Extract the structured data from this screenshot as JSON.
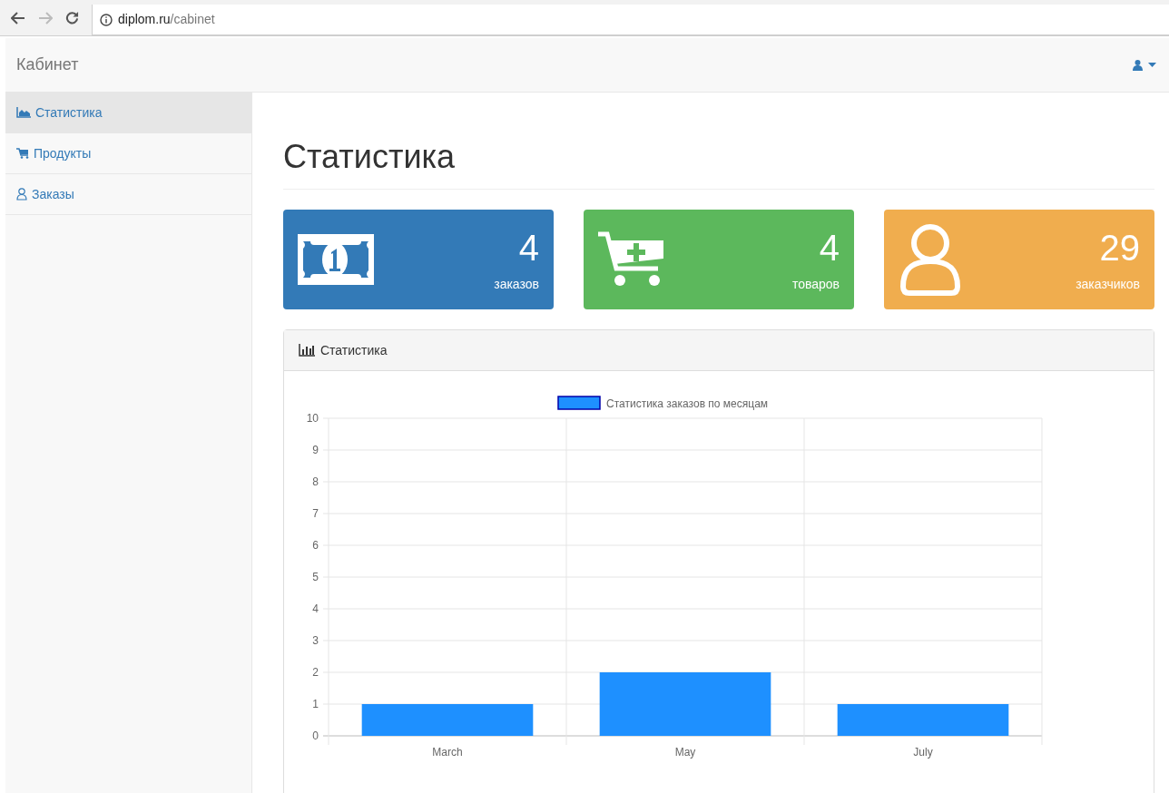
{
  "browser": {
    "url_host": "diplom.ru",
    "url_path": "/cabinet"
  },
  "navbar": {
    "brand": "Кабинет"
  },
  "sidebar": {
    "items": [
      {
        "label": "Статистика",
        "kind": "area-chart",
        "selected": true
      },
      {
        "label": "Продукты",
        "kind": "cart",
        "selected": false
      },
      {
        "label": "Заказы",
        "kind": "user",
        "selected": false
      }
    ]
  },
  "page_title": "Статистика",
  "stat_cards": [
    {
      "value": "4",
      "label": "заказов",
      "color": "#337ab7",
      "kind": "money"
    },
    {
      "value": "4",
      "label": "товаров",
      "color": "#5cb85c",
      "kind": "cart"
    },
    {
      "value": "29",
      "label": "заказчиков",
      "color": "#f0ad4e",
      "kind": "user"
    }
  ],
  "panel": {
    "title": "Статистика",
    "chart_data": {
      "type": "bar",
      "categories": [
        "March",
        "May",
        "July"
      ],
      "series": [
        {
          "name": "Статистика заказов по месяцам",
          "color": "#1e90ff",
          "values": [
            1,
            2,
            1
          ]
        }
      ],
      "grid": true,
      "ylim": [
        0,
        10
      ],
      "yticks": [
        0,
        1,
        2,
        3,
        4,
        5,
        6,
        7,
        8,
        9,
        10
      ]
    }
  }
}
